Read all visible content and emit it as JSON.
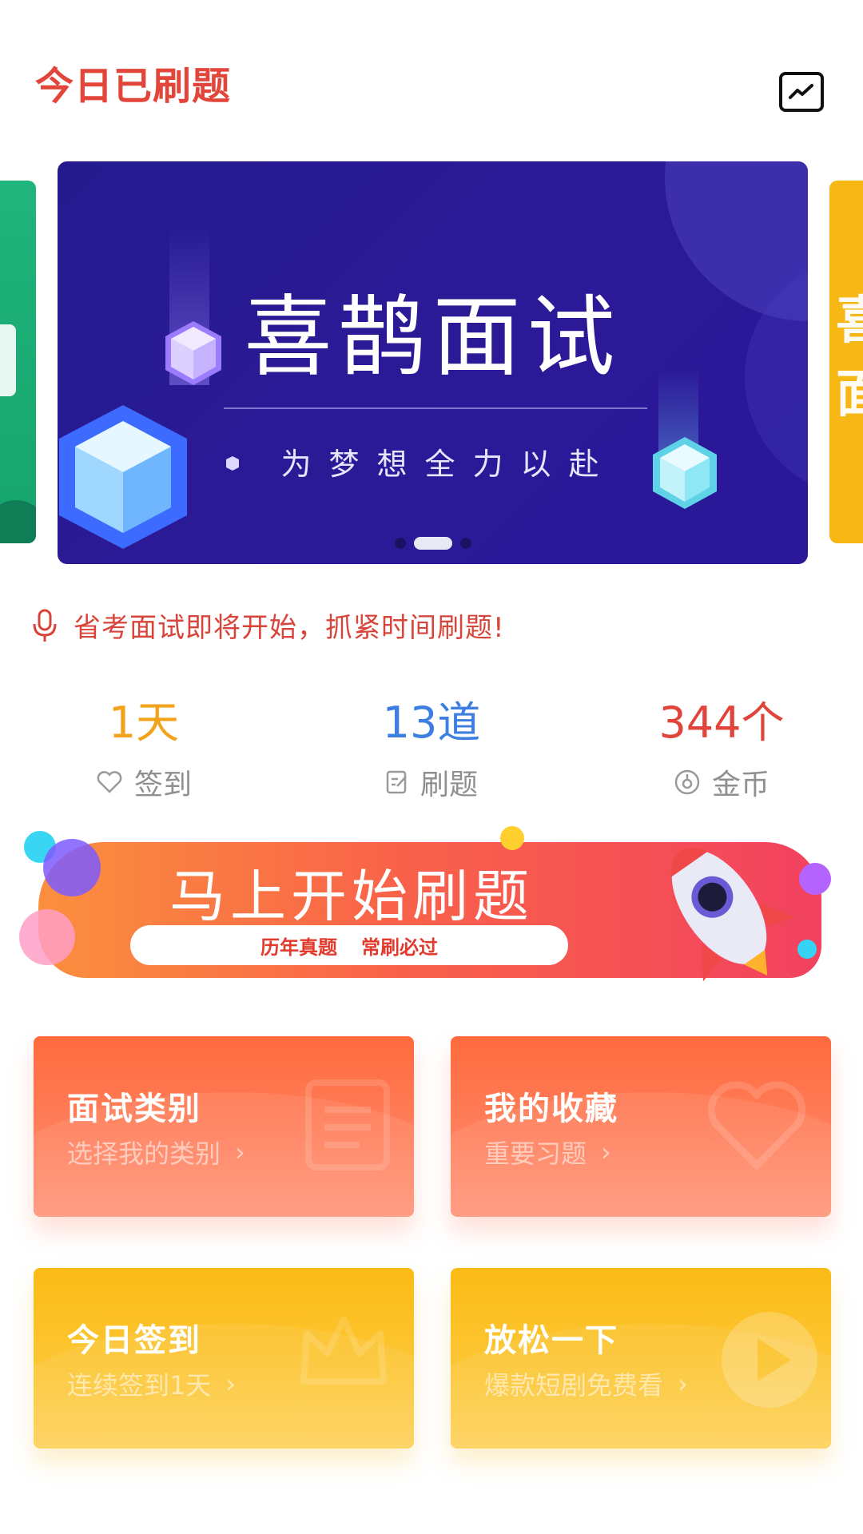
{
  "header": {
    "title": "今日已刷题"
  },
  "carousel": {
    "title": "喜鹊面试",
    "subtitle": "为梦想全力以赴",
    "next_peek_text": "喜面"
  },
  "notice": {
    "text": "省考面试即将开始，抓紧时间刷题!"
  },
  "stats": [
    {
      "value": "1天",
      "label": "签到",
      "color": "#f3a21b"
    },
    {
      "value": "13道",
      "label": "刷题",
      "color": "#3d7fe0"
    },
    {
      "value": "344个",
      "label": "金币",
      "color": "#e0443a"
    }
  ],
  "start_banner": {
    "title": "马上开始刷题",
    "tag1": "历年真题",
    "tag2": "常刷必过"
  },
  "cards": [
    {
      "title": "面试类别",
      "subtitle": "选择我的类别",
      "icon": "document-icon"
    },
    {
      "title": "我的收藏",
      "subtitle": "重要习题",
      "icon": "heart-icon"
    },
    {
      "title": "今日签到",
      "subtitle": "连续签到1天",
      "icon": "crown-icon"
    },
    {
      "title": "放松一下",
      "subtitle": "爆款短剧免费看",
      "icon": "play-icon"
    }
  ],
  "colors": {
    "accent_red": "#e2463b",
    "card_orange": "#ff7c57",
    "card_yellow": "#fcc531",
    "banner_blue": "#2a1a94"
  }
}
